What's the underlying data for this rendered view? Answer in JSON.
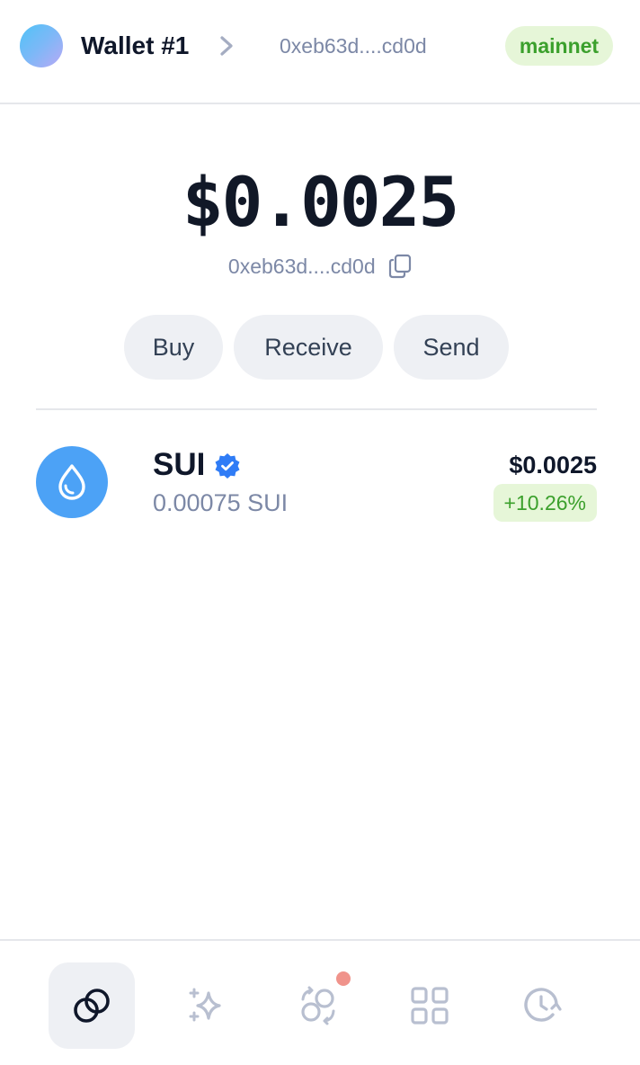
{
  "header": {
    "wallet_name": "Wallet #1",
    "address_short": "0xeb63d....cd0d",
    "network": "mainnet"
  },
  "balance": {
    "total_usd": "$0.0025",
    "address_short": "0xeb63d....cd0d"
  },
  "actions": {
    "buy": "Buy",
    "receive": "Receive",
    "send": "Send"
  },
  "tokens": [
    {
      "symbol": "SUI",
      "amount": "0.00075 SUI",
      "value_usd": "$0.0025",
      "change": "+10.26%",
      "icon": "sui-drop-icon",
      "verified_icon": "verified-badge-icon"
    }
  ],
  "nav": [
    {
      "icon": "coins-icon",
      "active": true
    },
    {
      "icon": "sparkles-icon",
      "active": false
    },
    {
      "icon": "swap-icon",
      "active": false,
      "notification": true
    },
    {
      "icon": "apps-grid-icon",
      "active": false
    },
    {
      "icon": "history-icon",
      "active": false
    }
  ],
  "colors": {
    "accent_green": "#3ba02c",
    "green_bg": "#e6f6d8",
    "sui_blue": "#4ca2f6",
    "muted_text": "#7c88a6",
    "button_bg": "#eef0f4",
    "notification_dot": "#f0938b"
  }
}
